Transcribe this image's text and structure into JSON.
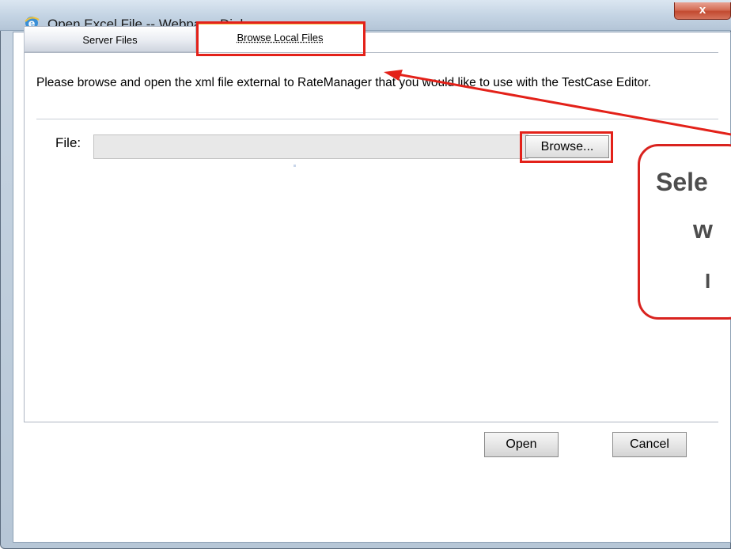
{
  "window": {
    "title": "Open Excel File -- Webpage Dialog",
    "close_label": "x",
    "title_icon": "ie-icon"
  },
  "tabs": [
    {
      "label": "Server Files",
      "active": false
    },
    {
      "label": "Browse Local Files",
      "active": true
    }
  ],
  "panel": {
    "description": "Please browse and open the xml file external to RateManager that you would like to use with the TestCase Editor.",
    "file_label": "File:",
    "file_value": "",
    "browse_label": "Browse..."
  },
  "footer": {
    "open_label": "Open",
    "cancel_label": "Cancel"
  },
  "callout": {
    "line1": "Sele",
    "line2": "w",
    "line3": "I"
  },
  "colors": {
    "highlight": "#e32119",
    "callout_border": "#d9231f",
    "active_tab_accent": "#f4c14f"
  }
}
